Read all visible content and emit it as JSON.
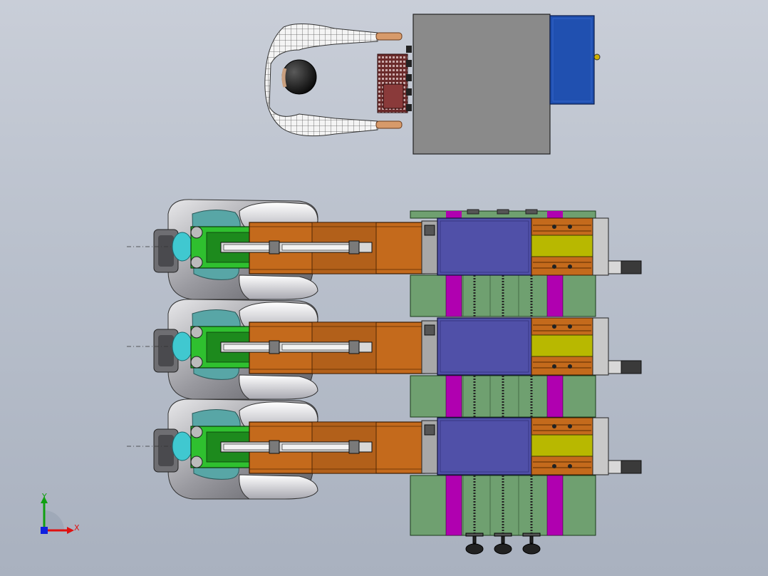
{
  "triad": {
    "x_label": "X",
    "y_label": "Y",
    "x_color": "#e01010",
    "y_color": "#10a010",
    "z_color": "#1020e0"
  },
  "colors": {
    "background": "#b9c0cc",
    "table_gray": "#8a8a8a",
    "control_box_blue": "#2050b0",
    "press_plate_green": "#6fa070",
    "guide_magenta": "#b000b0",
    "ram_block_blue": "#5050a8",
    "olive_block": "#b8b800",
    "orange_arm": "#c46a1c",
    "clamp_green": "#2fc02f",
    "teal_cap": "#40c0c0"
  },
  "assembly": {
    "station_count": 3,
    "operator_present": true
  }
}
